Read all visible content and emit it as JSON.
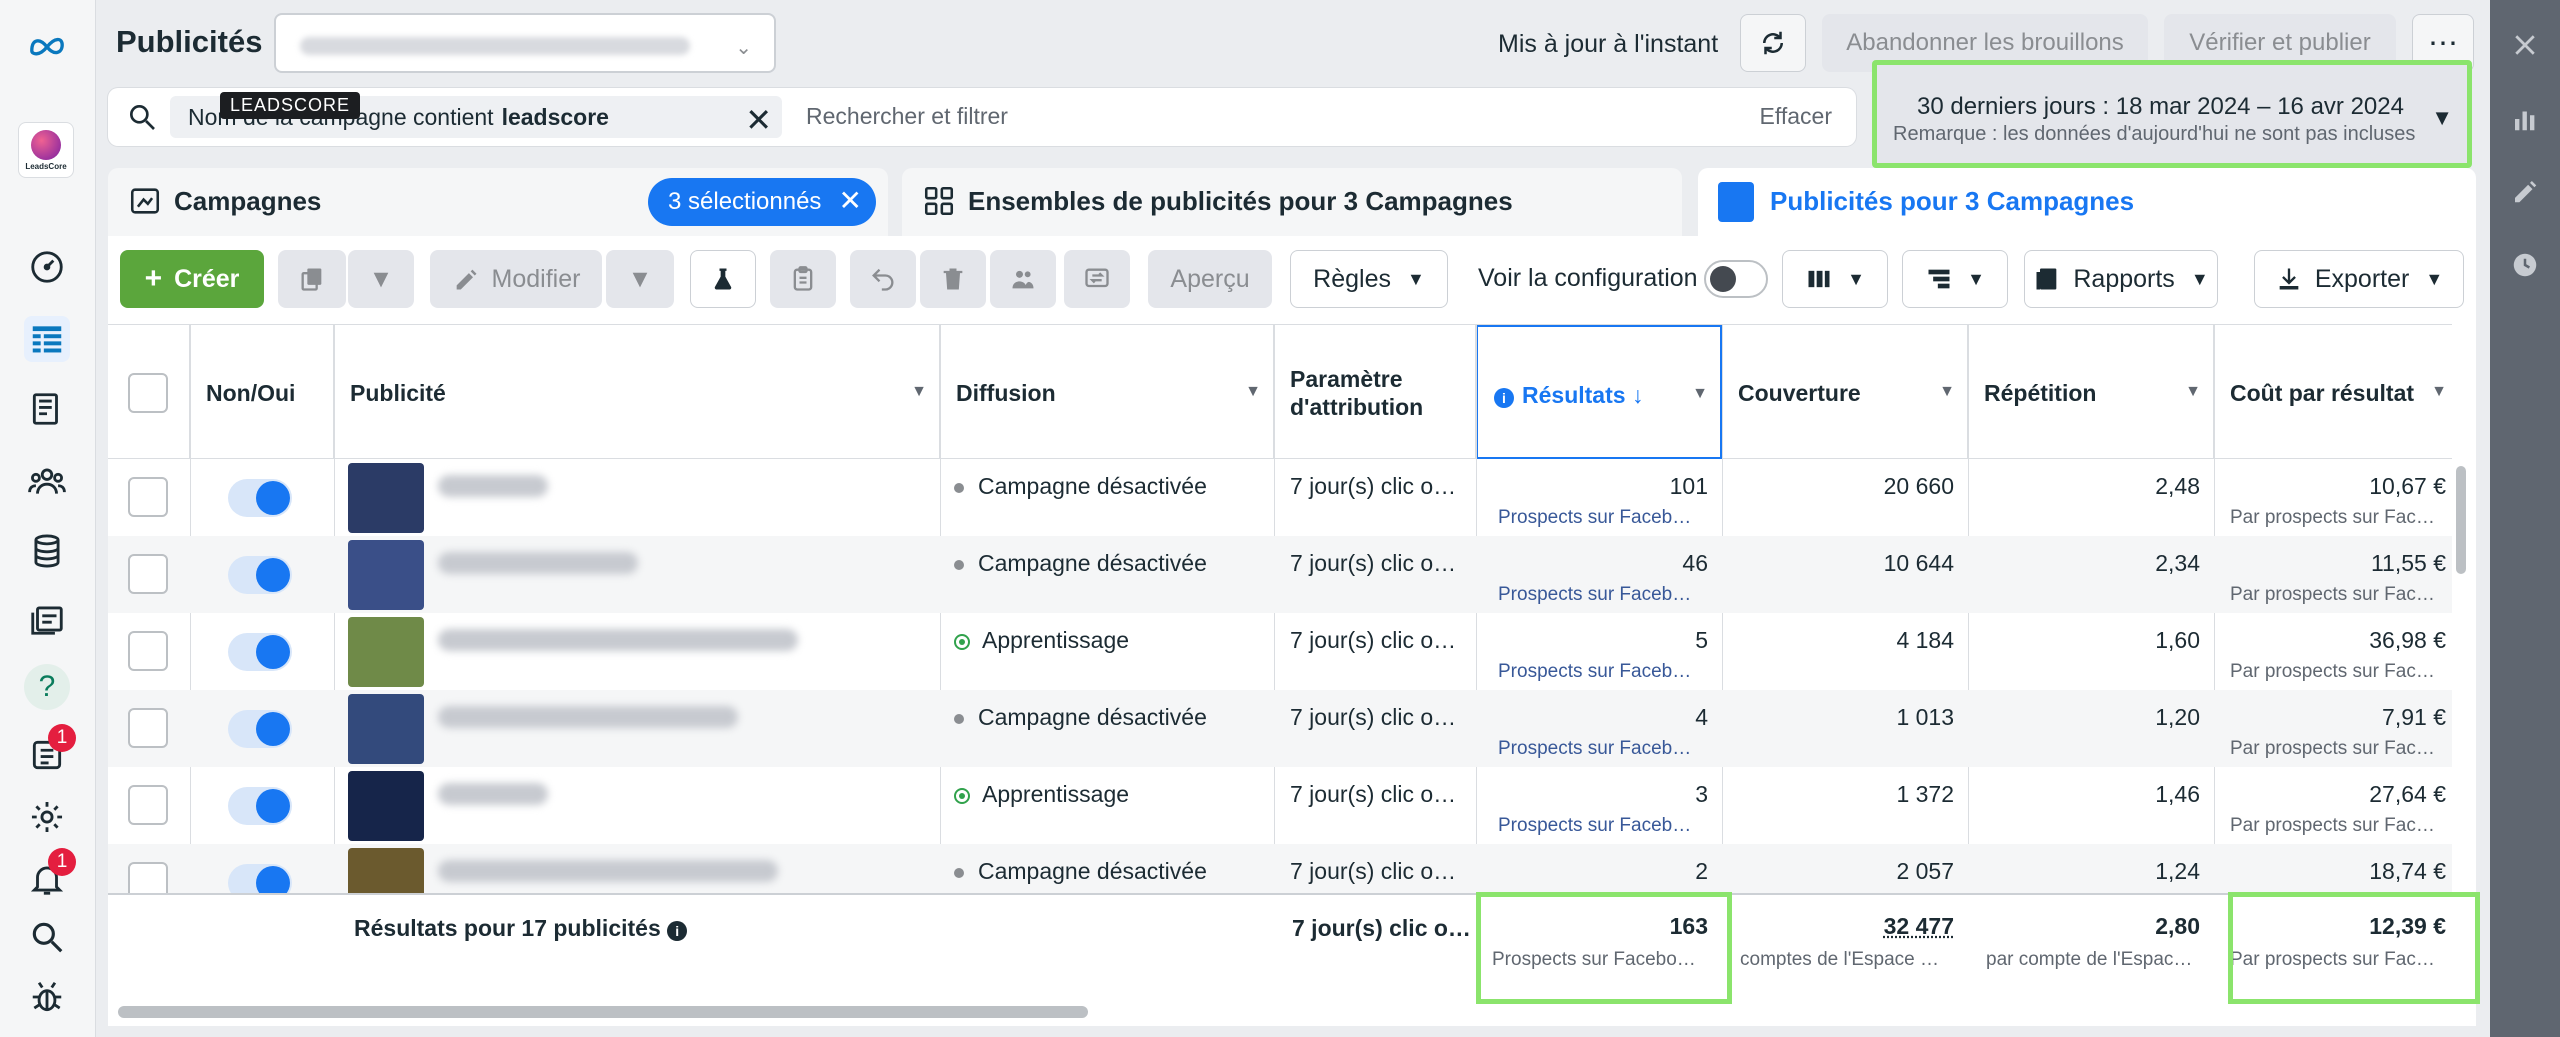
{
  "header": {
    "title": "Publicités",
    "updated": "Mis à jour à l'instant",
    "abandon": "Abandonner les brouillons",
    "verify": "Vérifier et publier"
  },
  "search": {
    "chip_prefix": "Nom de la campagne contient",
    "chip_value": "leadscore",
    "tooltip": "LEADSCORE",
    "placeholder": "Rechercher et filtrer",
    "clear": "Effacer"
  },
  "date_range": {
    "label": "30 derniers jours : 18 mar 2024 – 16 avr 2024",
    "note": "Remarque : les données d'aujourd'hui ne sont pas incluses"
  },
  "tabs": {
    "campaigns": "Campagnes",
    "selected": "3 sélectionnés",
    "adsets": "Ensembles de publicités pour 3 Campagnes",
    "ads": "Publicités pour 3 Campagnes"
  },
  "toolbar": {
    "create": "Créer",
    "modify": "Modifier",
    "preview": "Aperçu",
    "rules": "Règles",
    "config": "Voir la configuration",
    "reports": "Rapports",
    "export": "Exporter"
  },
  "table": {
    "headers": {
      "onoff": "Non/Oui",
      "ad": "Publicité",
      "delivery": "Diffusion",
      "attribution_1": "Paramètre",
      "attribution_2": "d'attribution",
      "results": "Résultats",
      "reach": "Couverture",
      "frequency": "Répétition",
      "cpr": "Coût par résultat"
    },
    "rows": [
      {
        "delivery": "Campagne désactivée",
        "status": "off",
        "attribution": "7 jour(s) clic o…",
        "results": "101",
        "results_sub": "Prospects sur Faceb…",
        "reach": "20 660",
        "frequency": "2,48",
        "cpr": "10,67 €",
        "cpr_sub": "Par prospects sur Fac…"
      },
      {
        "delivery": "Campagne désactivée",
        "status": "off",
        "attribution": "7 jour(s) clic o…",
        "results": "46",
        "results_sub": "Prospects sur Faceb…",
        "reach": "10 644",
        "frequency": "2,34",
        "cpr": "11,55 €",
        "cpr_sub": "Par prospects sur Fac…"
      },
      {
        "delivery": "Apprentissage",
        "status": "learning",
        "attribution": "7 jour(s) clic o…",
        "results": "5",
        "results_sub": "Prospects sur Faceb…",
        "reach": "4 184",
        "frequency": "1,60",
        "cpr": "36,98 €",
        "cpr_sub": "Par prospects sur Fac…"
      },
      {
        "delivery": "Campagne désactivée",
        "status": "off",
        "attribution": "7 jour(s) clic o…",
        "results": "4",
        "results_sub": "Prospects sur Faceb…",
        "reach": "1 013",
        "frequency": "1,20",
        "cpr": "7,91 €",
        "cpr_sub": "Par prospects sur Fac…"
      },
      {
        "delivery": "Apprentissage",
        "status": "learning",
        "attribution": "7 jour(s) clic o…",
        "results": "3",
        "results_sub": "Prospects sur Faceb…",
        "reach": "1 372",
        "frequency": "1,46",
        "cpr": "27,64 €",
        "cpr_sub": "Par prospects sur Fac…"
      },
      {
        "delivery": "Campagne désactivée",
        "status": "off",
        "attribution": "7 jour(s) clic o…",
        "results": "2",
        "results_sub": "",
        "reach": "2 057",
        "frequency": "1,24",
        "cpr": "18,74 €",
        "cpr_sub": ""
      }
    ],
    "footer": {
      "label": "Résultats pour 17 publicités",
      "attribution": "7 jour(s) clic o…",
      "results": "163",
      "results_sub": "Prospects sur Facebo…",
      "reach": "32 477",
      "reach_sub": "comptes de l'Espace …",
      "frequency": "2,80",
      "frequency_sub": "par compte de l'Espac…",
      "cpr": "12,39 €",
      "cpr_sub": "Par prospects sur Fac…"
    }
  },
  "nav": {
    "logo_word": "LeadsCore",
    "badge_1": "1",
    "badge_2": "1",
    "help": "?"
  },
  "colors": {
    "accent": "#1877f2",
    "create": "#5ba63c",
    "highlight": "#8be46c"
  }
}
